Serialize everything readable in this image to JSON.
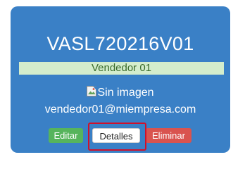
{
  "card": {
    "code": "VASL720216V01",
    "role": "Vendedor 01",
    "image_alt": "Sin imagen",
    "email": "vendedor01@miempresa.com"
  },
  "actions": {
    "edit_label": "Editar",
    "details_label": "Detalles",
    "delete_label": "Eliminar"
  },
  "colors": {
    "card_background": "#3a80c6",
    "role_bar_background": "#d4edcc",
    "edit_button": "#56b45c",
    "delete_button": "#d9534f",
    "highlight_border": "#d0102a"
  },
  "icons": {
    "broken_image": "broken-image-icon"
  }
}
